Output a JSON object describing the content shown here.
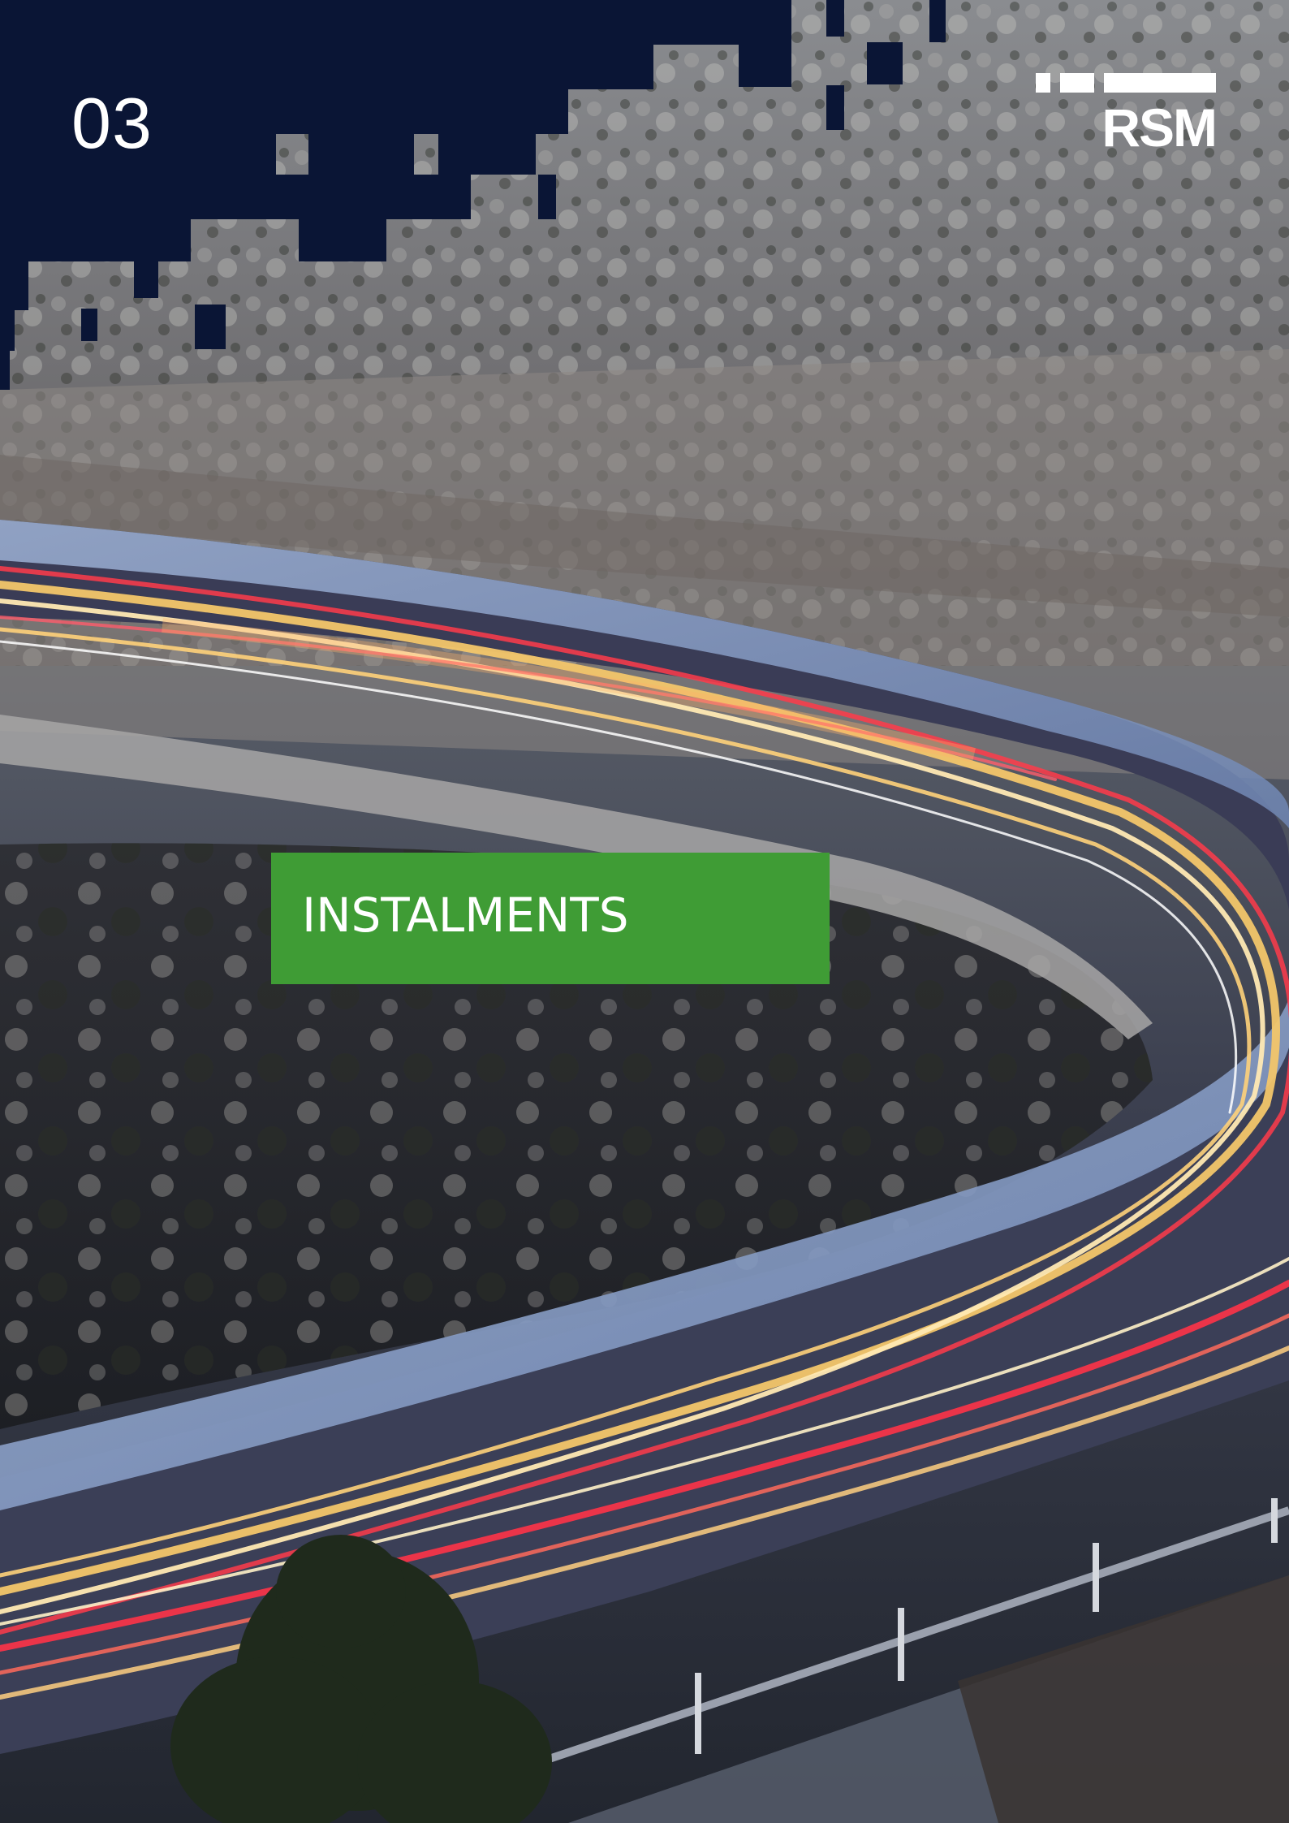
{
  "section": {
    "number": "03"
  },
  "brand": {
    "logo_text": "RSM",
    "logo_color": "#ffffff",
    "header_color": "#0a1535"
  },
  "title_box": {
    "label": "INSTALMENTS",
    "color": "#3f9c35"
  },
  "background": {
    "description_icon": "night-road-light-trails-photo"
  }
}
